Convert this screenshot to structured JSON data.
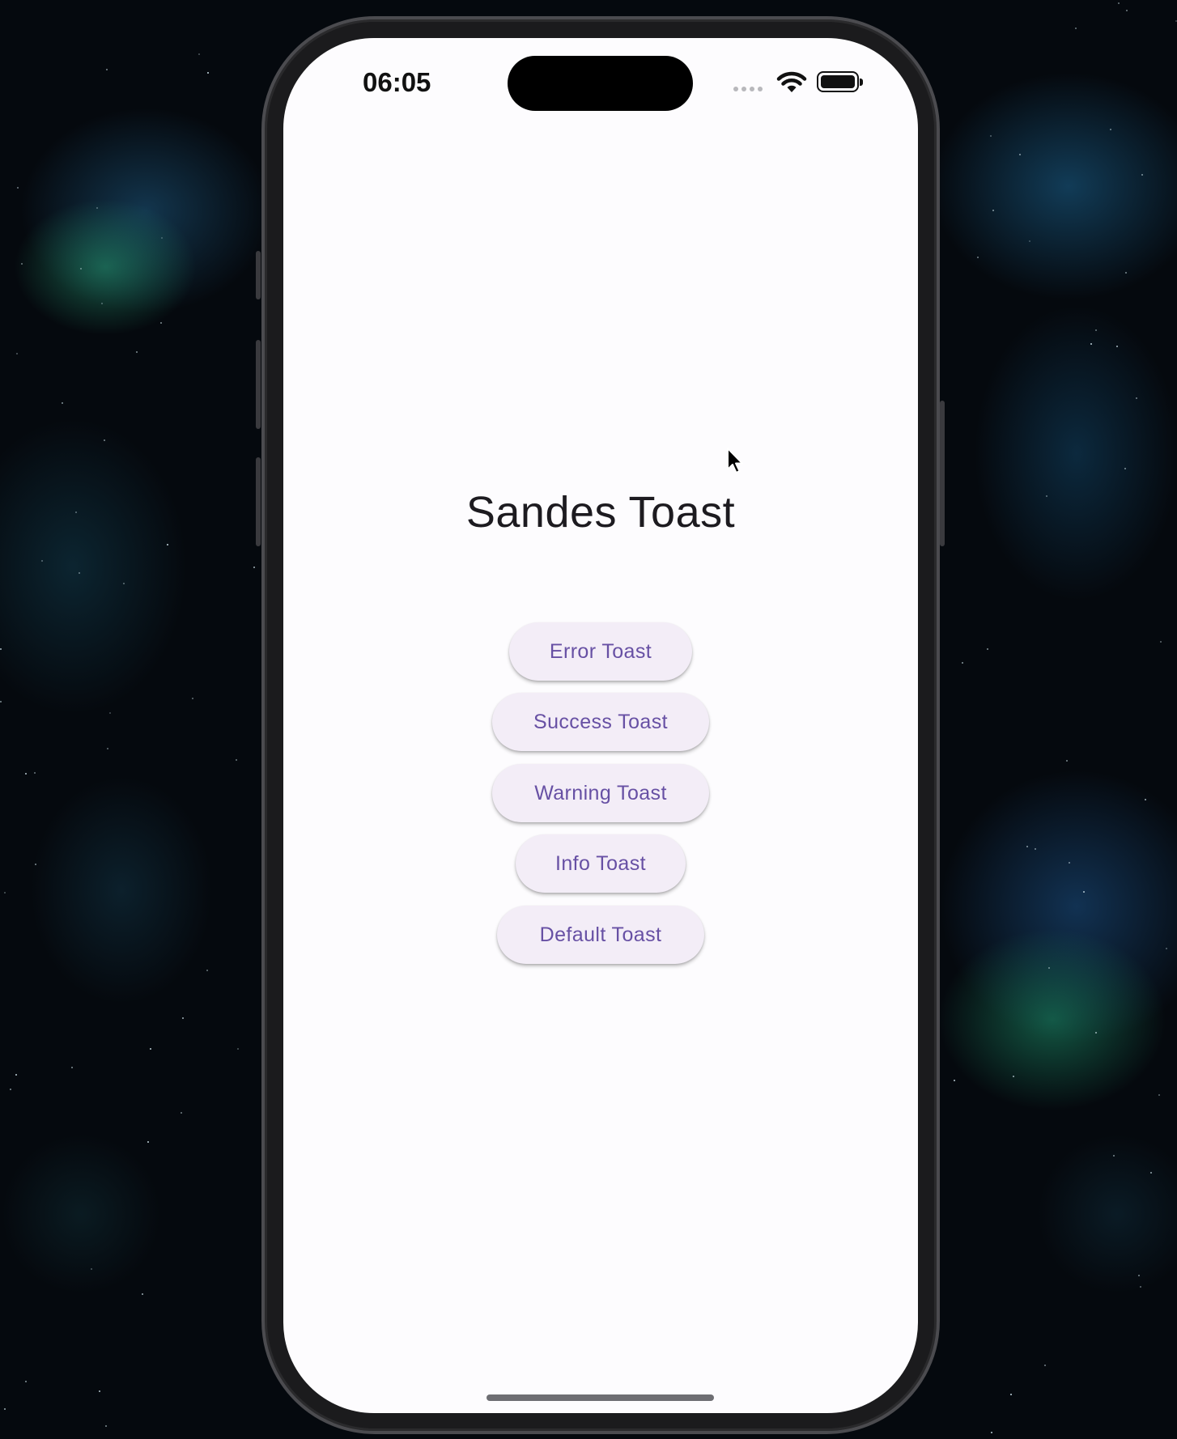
{
  "status_bar": {
    "time": "06:05",
    "icons": [
      "cellular-signal-icon",
      "wifi-icon",
      "battery-icon"
    ]
  },
  "app": {
    "title": "Sandes Toast",
    "buttons": [
      {
        "label": "Error Toast"
      },
      {
        "label": "Success Toast"
      },
      {
        "label": "Warning Toast"
      },
      {
        "label": "Info Toast"
      },
      {
        "label": "Default Toast"
      }
    ]
  },
  "theme": {
    "button_background": "#f3edf7",
    "button_text": "#6750a4",
    "title_text": "#1d1b20",
    "screen_background": "#fdfcfe"
  }
}
